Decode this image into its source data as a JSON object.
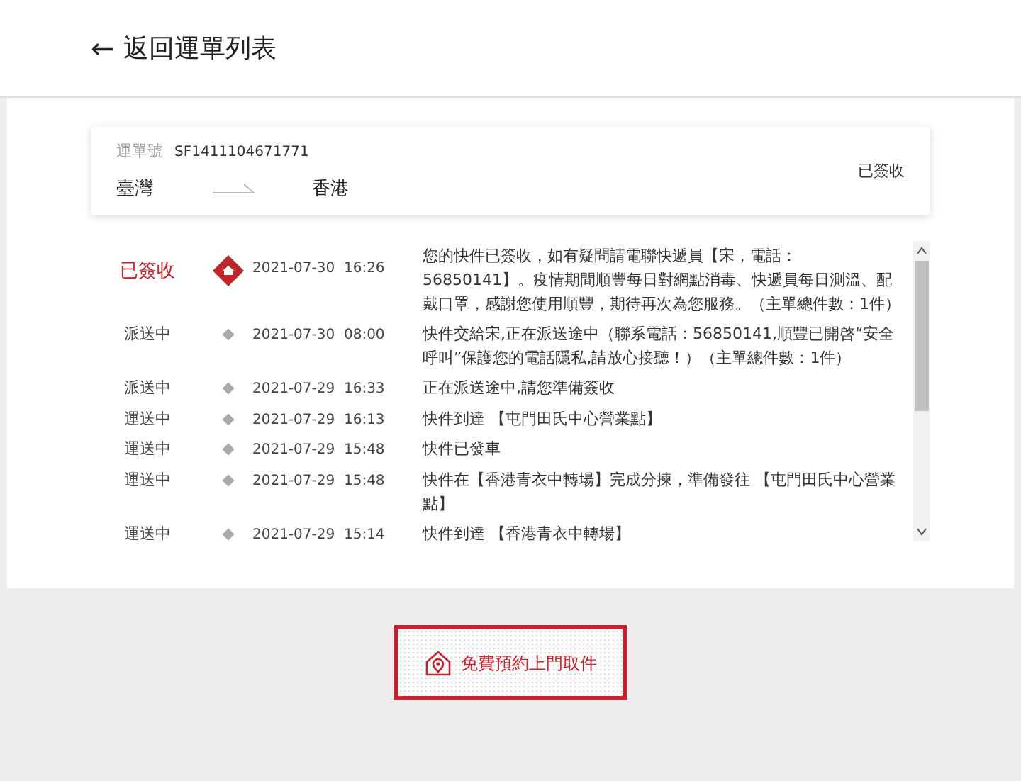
{
  "header": {
    "back_icon": "←",
    "title": "返回運單列表"
  },
  "waybill": {
    "label": "運單號",
    "number": "SF1411104671771",
    "origin": "臺灣",
    "destination": "香港",
    "status": "已簽收"
  },
  "events": [
    {
      "kind": "final",
      "status": "已簽收",
      "time": "2021-07-30  16:26",
      "text": "您的快件已簽收，如有疑問請電聯快遞員【宋，電話：56850141】。疫情期間順豐每日對網點消毒、快遞員每日測溫、配戴口罩，感謝您使用順豐，期待再次為您服務。（主單總件數：1件）"
    },
    {
      "kind": "step",
      "status": "派送中",
      "time": "2021-07-30  08:00",
      "text": "快件交給宋,正在派送途中（聯系電話：56850141,順豐已開啓“安全呼叫”保護您的電話隱私,請放心接聽！）（主單總件數：1件）"
    },
    {
      "kind": "step",
      "status": "派送中",
      "time": "2021-07-29  16:33",
      "text": "正在派送途中,請您準備簽收"
    },
    {
      "kind": "step",
      "status": "運送中",
      "time": "2021-07-29  16:13",
      "text": "快件到達 【屯門田氏中心營業點】"
    },
    {
      "kind": "step",
      "status": "運送中",
      "time": "2021-07-29  15:48",
      "text": "快件已發車"
    },
    {
      "kind": "step",
      "status": "運送中",
      "time": "2021-07-29  15:48",
      "text": "快件在【香港青衣中轉場】完成分揀，準備發往 【屯門田氏中心營業點】"
    },
    {
      "kind": "step",
      "status": "運送中",
      "time": "2021-07-29  15:14",
      "text": "快件到達 【香港青衣中轉場】"
    }
  ],
  "pickup_button": {
    "label": "免費預約上門取件"
  }
}
